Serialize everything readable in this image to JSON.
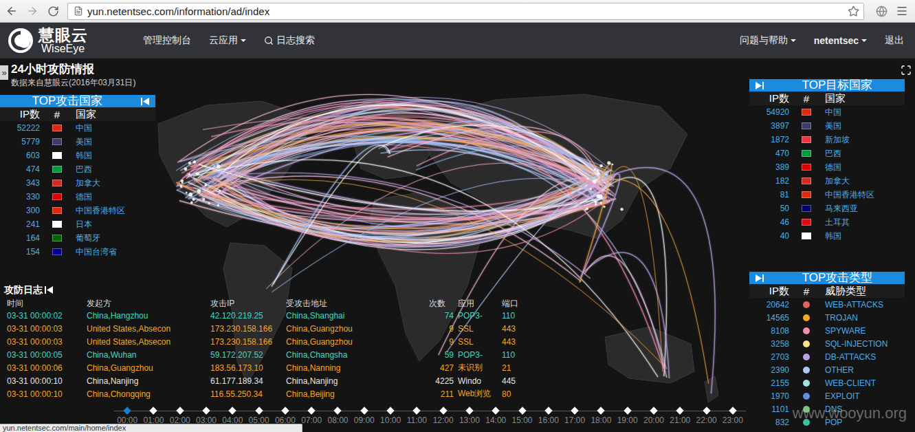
{
  "browser": {
    "url": "yun.netentsec.com/information/ad/index",
    "status_link": "yun.netentsec.com/main/home/index"
  },
  "nav": {
    "logo_cn": "慧眼云",
    "logo_en": "WiseEye",
    "items": [
      {
        "label": "管理控制台",
        "kind": "link"
      },
      {
        "label": "云应用",
        "kind": "dropdown"
      },
      {
        "label": "日志搜索",
        "kind": "search"
      }
    ],
    "right": [
      {
        "label": "问题与帮助",
        "kind": "dropdown"
      },
      {
        "label": "netentsec",
        "kind": "dropdown"
      },
      {
        "label": "退出",
        "kind": "link"
      }
    ]
  },
  "page": {
    "side_handle": "»",
    "title": "24小时攻防情报",
    "subtitle": "数据来自慧眼云(2016年03月31日)"
  },
  "top_attack_countries": {
    "title": "TOP攻击国家",
    "columns": [
      "IP数",
      "#",
      "国家"
    ],
    "rows": [
      {
        "count": "52222",
        "country": "中国",
        "color": "#de2910"
      },
      {
        "count": "5779",
        "country": "美国",
        "color": "#3c3b6e"
      },
      {
        "count": "603",
        "country": "韩国",
        "color": "#ffffff"
      },
      {
        "count": "474",
        "country": "巴西",
        "color": "#009b3a"
      },
      {
        "count": "343",
        "country": "加拿大",
        "color": "#d52b1e"
      },
      {
        "count": "330",
        "country": "德国",
        "color": "#dd0000"
      },
      {
        "count": "300",
        "country": "中国香港特区",
        "color": "#de2910"
      },
      {
        "count": "241",
        "country": "日本",
        "color": "#ffffff"
      },
      {
        "count": "164",
        "country": "葡萄牙",
        "color": "#006600"
      },
      {
        "count": "154",
        "country": "中国台湾省",
        "color": "#000095"
      }
    ]
  },
  "top_target_countries": {
    "title": "TOP目标国家",
    "columns": [
      "IP数",
      "#",
      "国家"
    ],
    "rows": [
      {
        "count": "54920",
        "country": "中国",
        "color": "#de2910"
      },
      {
        "count": "3897",
        "country": "美国",
        "color": "#3c3b6e"
      },
      {
        "count": "1872",
        "country": "新加坡",
        "color": "#ef3340"
      },
      {
        "count": "470",
        "country": "巴西",
        "color": "#009b3a"
      },
      {
        "count": "389",
        "country": "德国",
        "color": "#dd0000"
      },
      {
        "count": "182",
        "country": "加拿大",
        "color": "#d52b1e"
      },
      {
        "count": "81",
        "country": "中国香港特区",
        "color": "#de2910"
      },
      {
        "count": "50",
        "country": "马来西亚",
        "color": "#010066"
      },
      {
        "count": "46",
        "country": "土耳其",
        "color": "#e30a17"
      },
      {
        "count": "40",
        "country": "韩国",
        "color": "#ffffff"
      }
    ]
  },
  "top_threat_types": {
    "title": "TOP攻击类型",
    "columns": [
      "IP数",
      "#",
      "威胁类型"
    ],
    "rows": [
      {
        "count": "20642",
        "type": "WEB-ATTACKS",
        "color": "#e0665a"
      },
      {
        "count": "14565",
        "type": "TROJAN",
        "color": "#f5a623"
      },
      {
        "count": "8108",
        "type": "SPYWARE",
        "color": "#f28db0"
      },
      {
        "count": "3258",
        "type": "SQL-INJECTION",
        "color": "#f5e28a"
      },
      {
        "count": "2703",
        "type": "DB-ATTACKS",
        "color": "#b9a2e3"
      },
      {
        "count": "2390",
        "type": "OTHER",
        "color": "#a9c9f2"
      },
      {
        "count": "2155",
        "type": "WEB-CLIENT",
        "color": "#a3e2e0"
      },
      {
        "count": "1970",
        "type": "EXPLOIT",
        "color": "#5f8fe0"
      },
      {
        "count": "1101",
        "type": "DNS",
        "color": "#7cc47c"
      },
      {
        "count": "832",
        "type": "POP",
        "color": "#3cc0a0"
      }
    ]
  },
  "attack_log": {
    "title": "攻防日志",
    "columns": [
      "时间",
      "发起方",
      "攻击IP",
      "受攻击地址",
      "次数",
      "应用",
      "端口"
    ],
    "rows": [
      {
        "time": "03-31 00:00:02",
        "source": "China,Hangzhou",
        "ip": "42.120.219.25",
        "target": "China,Shanghai",
        "count": "74",
        "app": "POP3-",
        "port": "110",
        "color": "#3fd9c2"
      },
      {
        "time": "03-31 00:00:03",
        "source": "United States,Absecon",
        "ip": "173.230.158.166",
        "target": "China,Guangzhou",
        "count": "9",
        "app": "SSL",
        "port": "443",
        "color": "#f5a623"
      },
      {
        "time": "03-31 00:00:03",
        "source": "United States,Absecon",
        "ip": "173.230.158.166",
        "target": "China,Guangzhou",
        "count": "9",
        "app": "SSL",
        "port": "443",
        "color": "#f5a623"
      },
      {
        "time": "03-31 00:00:05",
        "source": "China,Wuhan",
        "ip": "59.172.207.52",
        "target": "China,Changsha",
        "count": "59",
        "app": "POP3-",
        "port": "110",
        "color": "#3fd9c2"
      },
      {
        "time": "03-31 00:00:06",
        "source": "China,Guangzhou",
        "ip": "183.56.173.10",
        "target": "China,Nanning",
        "count": "427",
        "app": "未识别",
        "port": "21",
        "color": "#f5a623"
      },
      {
        "time": "03-31 00:00:10",
        "source": "China,Nanjing",
        "ip": "61.177.189.34",
        "target": "China,Nanjing",
        "count": "4225",
        "app": "Windo",
        "port": "445",
        "color": "#e6e6e6"
      },
      {
        "time": "03-31 00:00:10",
        "source": "China,Chongqing",
        "ip": "116.55.250.34",
        "target": "China,Beijing",
        "count": "211",
        "app": "Web浏览",
        "port": "80",
        "color": "#f5a623"
      }
    ]
  },
  "timeline": {
    "ticks": [
      {
        "label": "00:00",
        "selected": true
      },
      {
        "label": "01:00",
        "selected": false
      },
      {
        "label": "02:00",
        "selected": false
      },
      {
        "label": "03:00",
        "selected": false
      },
      {
        "label": "04:00",
        "selected": false
      },
      {
        "label": "05:00",
        "selected": false
      },
      {
        "label": "06:00",
        "selected": false
      },
      {
        "label": "07:00",
        "selected": false
      },
      {
        "label": "08:00",
        "selected": false
      },
      {
        "label": "09:00",
        "selected": false
      },
      {
        "label": "10:00",
        "selected": false
      },
      {
        "label": "11:00",
        "selected": false
      },
      {
        "label": "12:00",
        "selected": false
      },
      {
        "label": "13:00",
        "selected": false
      },
      {
        "label": "14:00",
        "selected": false
      },
      {
        "label": "15:00",
        "selected": false
      },
      {
        "label": "16:00",
        "selected": false
      },
      {
        "label": "17:00",
        "selected": false
      },
      {
        "label": "18:00",
        "selected": false
      },
      {
        "label": "19:00",
        "selected": false
      },
      {
        "label": "20:00",
        "selected": false
      },
      {
        "label": "21:00",
        "selected": false
      },
      {
        "label": "22:00",
        "selected": false
      },
      {
        "label": "23:00",
        "selected": false
      }
    ]
  },
  "watermark": "www.wooyun.org"
}
